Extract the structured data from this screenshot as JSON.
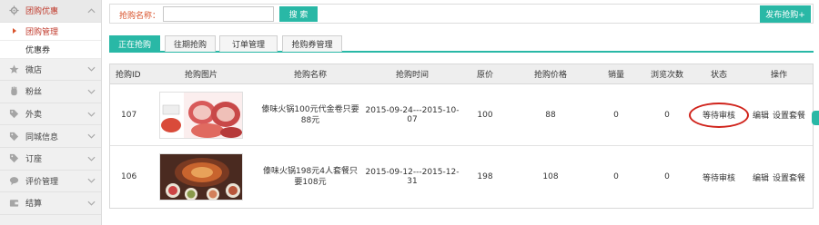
{
  "sidebar": {
    "header": {
      "label": "团购优惠",
      "icon": "gear-icon"
    },
    "sub_items": [
      {
        "label": "团购管理",
        "active": true
      },
      {
        "label": "优惠券",
        "active": false
      }
    ],
    "items": [
      {
        "label": "微店",
        "icon": "star-icon"
      },
      {
        "label": "粉丝",
        "icon": "hand-icon"
      },
      {
        "label": "外卖",
        "icon": "tag-icon"
      },
      {
        "label": "同城信息",
        "icon": "tag-icon"
      },
      {
        "label": "订座",
        "icon": "tag-icon"
      },
      {
        "label": "评价管理",
        "icon": "comment-icon"
      },
      {
        "label": "结算",
        "icon": "wallet-icon"
      }
    ]
  },
  "search": {
    "label": "抢购名称：",
    "value": "",
    "placeholder": "",
    "button": "搜 索",
    "publish_button": "发布抢购+"
  },
  "tabs": [
    {
      "label": "正在抢购",
      "active": true
    },
    {
      "label": "往期抢购",
      "active": false
    },
    {
      "label": "订单管理",
      "active": false
    },
    {
      "label": "抢购券管理",
      "active": false
    }
  ],
  "table": {
    "headers": [
      "抢购ID",
      "抢购图片",
      "抢购名称",
      "抢购时间",
      "原价",
      "抢购价格",
      "销量",
      "浏览次数",
      "状态",
      "操作"
    ],
    "rows": [
      {
        "id": "107",
        "name": "傣味火锅100元代金卷只要88元",
        "time": "2015-09-24---2015-10-07",
        "orig": "100",
        "price": "88",
        "sales": "0",
        "views": "0",
        "status": "等待审核",
        "op1": "编辑",
        "op2": "设置套餐",
        "highlighted": true
      },
      {
        "id": "106",
        "name": "傣味火锅198元4人套餐只要108元",
        "time": "2015-09-12---2015-12-31",
        "orig": "198",
        "price": "108",
        "sales": "0",
        "views": "0",
        "status": "等待审核",
        "op1": "编辑",
        "op2": "设置套餐",
        "highlighted": false
      }
    ]
  },
  "colors": {
    "accent": "#29b8a6",
    "alert": "#d9532c",
    "circle": "#d0231b"
  }
}
